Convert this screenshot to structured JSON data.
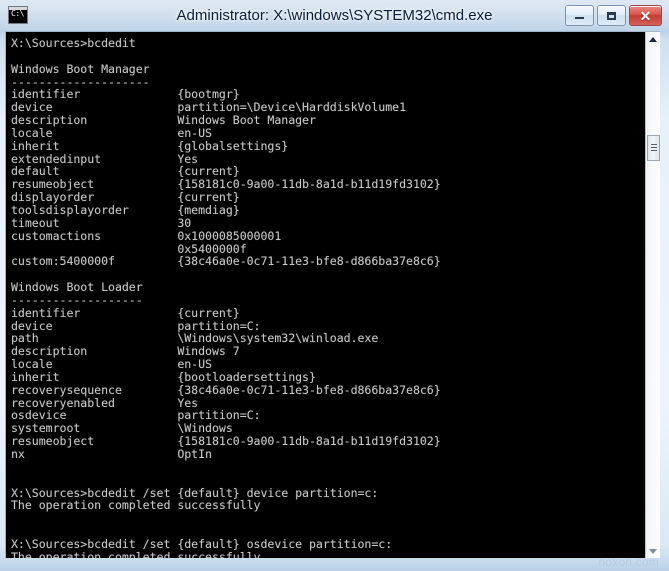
{
  "window": {
    "title": "Administrator: X:\\windows\\SYSTEM32\\cmd.exe",
    "icon_label": "C:\\",
    "minimize_label": "",
    "maximize_label": "",
    "close_label": "✕",
    "watermark": "noxon.com"
  },
  "colors": {
    "console_bg": "#000000",
    "console_fg": "#c7c7c7",
    "frame": "#cfe0ee",
    "close_button": "#c23c35"
  },
  "scrollbar": {
    "up_arrow": "▲",
    "down_arrow": "▼"
  },
  "console": {
    "text": "X:\\Sources>bcdedit\n\nWindows Boot Manager\n--------------------\nidentifier              {bootmgr}\ndevice                  partition=\\Device\\HarddiskVolume1\ndescription             Windows Boot Manager\nlocale                  en-US\ninherit                 {globalsettings}\nextendedinput           Yes\ndefault                 {current}\nresumeobject            {158181c0-9a00-11db-8a1d-b11d19fd3102}\ndisplayorder            {current}\ntoolsdisplayorder       {memdiag}\ntimeout                 30\ncustomactions           0x1000085000001\n                        0x5400000f\ncustom:5400000f         {38c46a0e-0c71-11e3-bfe8-d866ba37e8c6}\n\nWindows Boot Loader\n-------------------\nidentifier              {current}\ndevice                  partition=C:\npath                    \\Windows\\system32\\winload.exe\ndescription             Windows 7\nlocale                  en-US\ninherit                 {bootloadersettings}\nrecoverysequence        {38c46a0e-0c71-11e3-bfe8-d866ba37e8c6}\nrecoveryenabled         Yes\nosdevice                partition=C:\nsystemroot              \\Windows\nresumeobject            {158181c0-9a00-11db-8a1d-b11d19fd3102}\nnx                      OptIn\n\n\nX:\\Sources>bcdedit /set {default} device partition=c:\nThe operation completed successfully\n\n\nX:\\Sources>bcdedit /set {default} osdevice partition=c:\nThe operation completed successfully",
    "prompt": "X:\\Sources>",
    "commands": [
      "bcdedit",
      "bcdedit /set {default} device partition=c:",
      "bcdedit /set {default} osdevice partition=c:"
    ],
    "responses": [
      "The operation completed successfully",
      "The operation completed successfully"
    ],
    "sections": [
      {
        "heading": "Windows Boot Manager",
        "rule": "--------------------",
        "entries": [
          {
            "key": "identifier",
            "value": "{bootmgr}"
          },
          {
            "key": "device",
            "value": "partition=\\Device\\HarddiskVolume1"
          },
          {
            "key": "description",
            "value": "Windows Boot Manager"
          },
          {
            "key": "locale",
            "value": "en-US"
          },
          {
            "key": "inherit",
            "value": "{globalsettings}"
          },
          {
            "key": "extendedinput",
            "value": "Yes"
          },
          {
            "key": "default",
            "value": "{current}"
          },
          {
            "key": "resumeobject",
            "value": "{158181c0-9a00-11db-8a1d-b11d19fd3102}"
          },
          {
            "key": "displayorder",
            "value": "{current}"
          },
          {
            "key": "toolsdisplayorder",
            "value": "{memdiag}"
          },
          {
            "key": "timeout",
            "value": "30"
          },
          {
            "key": "customactions",
            "value": "0x1000085000001"
          },
          {
            "key": "",
            "value": "0x5400000f"
          },
          {
            "key": "custom:5400000f",
            "value": "{38c46a0e-0c71-11e3-bfe8-d866ba37e8c6}"
          }
        ]
      },
      {
        "heading": "Windows Boot Loader",
        "rule": "-------------------",
        "entries": [
          {
            "key": "identifier",
            "value": "{current}"
          },
          {
            "key": "device",
            "value": "partition=C:"
          },
          {
            "key": "path",
            "value": "\\Windows\\system32\\winload.exe"
          },
          {
            "key": "description",
            "value": "Windows 7"
          },
          {
            "key": "locale",
            "value": "en-US"
          },
          {
            "key": "inherit",
            "value": "{bootloadersettings}"
          },
          {
            "key": "recoverysequence",
            "value": "{38c46a0e-0c71-11e3-bfe8-d866ba37e8c6}"
          },
          {
            "key": "recoveryenabled",
            "value": "Yes"
          },
          {
            "key": "osdevice",
            "value": "partition=C:"
          },
          {
            "key": "systemroot",
            "value": "\\Windows"
          },
          {
            "key": "resumeobject",
            "value": "{158181c0-9a00-11db-8a1d-b11d19fd3102}"
          },
          {
            "key": "nx",
            "value": "OptIn"
          }
        ]
      }
    ]
  }
}
